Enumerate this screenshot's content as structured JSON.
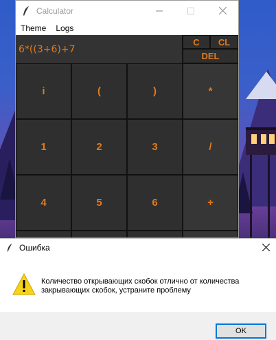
{
  "calculator": {
    "title": "Calculator",
    "menu": [
      "Theme",
      "Logs"
    ],
    "display": "6*((3+6)+7",
    "controls": {
      "clear": "C",
      "clear_log": "CL",
      "delete": "DEL"
    },
    "keys": [
      "i",
      "(",
      ")",
      "*",
      "1",
      "2",
      "3",
      "/",
      "4",
      "5",
      "6",
      "+",
      "",
      "",
      "",
      ""
    ],
    "accent_color": "#e27a1e"
  },
  "dialog": {
    "title": "Ошибка",
    "message": "Количество открывающих скобок отлично от количества закрывающих скобок, устраните проблему",
    "ok_label": "OK"
  }
}
